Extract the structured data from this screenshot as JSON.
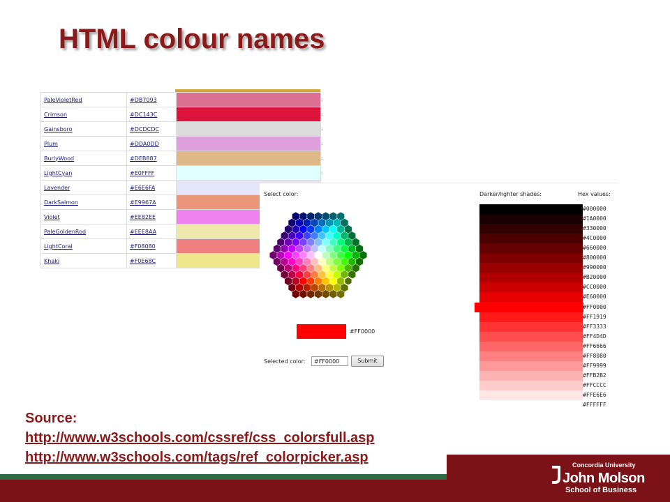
{
  "slide": {
    "title": "HTML colour names"
  },
  "color_table": {
    "rows": [
      {
        "name": "PaleVioletRed",
        "hex": "#DB7093",
        "color": "#DB7093"
      },
      {
        "name": "Crimson",
        "hex": "#DC143C",
        "color": "#DC143C"
      },
      {
        "name": "Gainsboro",
        "hex": "#DCDCDC",
        "color": "#DCDCDC"
      },
      {
        "name": "Plum",
        "hex": "#DDA0DD",
        "color": "#DDA0DD"
      },
      {
        "name": "BurlyWood",
        "hex": "#DEB887",
        "color": "#DEB887"
      },
      {
        "name": "LightCyan",
        "hex": "#E0FFFF",
        "color": "#E0FFFF"
      },
      {
        "name": "Lavender",
        "hex": "#E6E6FA",
        "color": "#E6E6FA"
      },
      {
        "name": "DarkSalmon",
        "hex": "#E9967A",
        "color": "#E9967A"
      },
      {
        "name": "Violet",
        "hex": "#EE82EE",
        "color": "#EE82EE"
      },
      {
        "name": "PaleGoldenRod",
        "hex": "#EEE8AA",
        "color": "#EEE8AA"
      },
      {
        "name": "LightCoral",
        "hex": "#F08080",
        "color": "#F08080"
      },
      {
        "name": "Khaki",
        "hex": "#F0E68C",
        "color": "#F0E68C"
      }
    ]
  },
  "picker": {
    "select_label": "Select color:",
    "shades_label": "Darker/lighter shades:",
    "hex_label": "Hex values:",
    "preview_hex": "#FF0000",
    "selected_label": "Selected color:",
    "selected_value": "#FF0000",
    "submit_label": "Submit",
    "shades": [
      "#000000",
      "#1A0000",
      "#330000",
      "#4C0000",
      "#660000",
      "#800000",
      "#990000",
      "#B20000",
      "#CC0000",
      "#E60000",
      "#FF0000",
      "#FF1919",
      "#FF3333",
      "#FF4D4D",
      "#FF6666",
      "#FF8080",
      "#FF9999",
      "#FFB2B2",
      "#FFCCCC",
      "#FFE6E6",
      "#FFFFFF"
    ],
    "selected_shade": "#FF0000"
  },
  "source": {
    "label": "Source:",
    "link1": "http://www.w3schools.com/cssref/css_colorsfull.asp",
    "link2": "http://www.w3schools.com/tags/ref_colorpicker.asp"
  },
  "footer": {
    "line1": "Concordia University",
    "line2": "John Molson",
    "line3": "School of Business",
    "colors": {
      "green": "#2e6b45",
      "maroon": "#7a1218"
    }
  }
}
